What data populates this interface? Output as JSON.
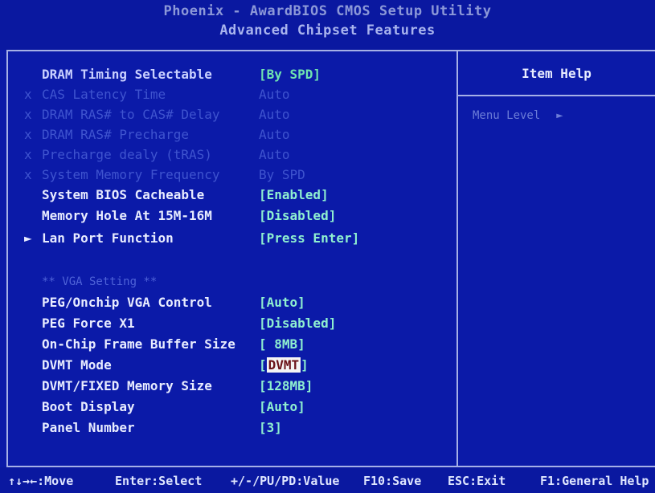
{
  "header": {
    "title_line1": "Phoenix - AwardBIOS CMOS Setup Utility",
    "title_line2": "Advanced Chipset Features"
  },
  "help_panel": {
    "title": "Item Help",
    "menu_level_label": "Menu Level",
    "menu_level_arrow": "►"
  },
  "settings": [
    {
      "marker": "",
      "label": "DRAM Timing Selectable",
      "value": "[By SPD]",
      "state": "active"
    },
    {
      "marker": "x",
      "label": "CAS Latency Time",
      "value": "Auto",
      "state": "dim"
    },
    {
      "marker": "x",
      "label": "DRAM RAS# to CAS# Delay",
      "value": "Auto",
      "state": "dim"
    },
    {
      "marker": "x",
      "label": "DRAM RAS# Precharge",
      "value": "Auto",
      "state": "dim"
    },
    {
      "marker": "x",
      "label": "Precharge dealy (tRAS)",
      "value": "Auto",
      "state": "dim"
    },
    {
      "marker": "x",
      "label": "System Memory Frequency",
      "value": "By SPD",
      "state": "dim"
    },
    {
      "marker": "",
      "label": "System BIOS Cacheable",
      "value": "[Enabled]",
      "state": "active"
    },
    {
      "marker": "",
      "label": "Memory Hole At 15M-16M",
      "value": "[Disabled]",
      "state": "active"
    },
    {
      "marker": "►",
      "label": "Lan Port Function",
      "value": "[Press Enter]",
      "state": "active"
    }
  ],
  "vga_section": {
    "label": "** VGA Setting **",
    "items": [
      {
        "label": "PEG/Onchip VGA Control",
        "value": "[Auto]"
      },
      {
        "label": "PEG Force X1",
        "value": "[Disabled]"
      },
      {
        "label": "On-Chip Frame Buffer Size",
        "value": "[ 8MB]"
      },
      {
        "label": "DVMT Mode",
        "value_prefix": "[",
        "value_highlight": "DVMT",
        "value_suffix": "]",
        "selected": true
      },
      {
        "label": "DVMT/FIXED Memory Size",
        "value": "[128MB]"
      },
      {
        "label": "Boot Display",
        "value": "[Auto]"
      },
      {
        "label": "Panel Number",
        "value": "[3]"
      }
    ]
  },
  "footer": {
    "move": "↑↓→←:Move",
    "select": "Enter:Select",
    "value": "+/-/PU/PD:Value",
    "save": "F10:Save",
    "exit": "ESC:Exit",
    "help": "F1:General Help"
  },
  "colors": {
    "background": "#0b1aa8",
    "text": "#e8ecff",
    "value_text": "#8ff0d0",
    "disabled_text": "#3f54cf",
    "highlight_bg": "#f4f4f4",
    "highlight_text": "#6a1218"
  }
}
